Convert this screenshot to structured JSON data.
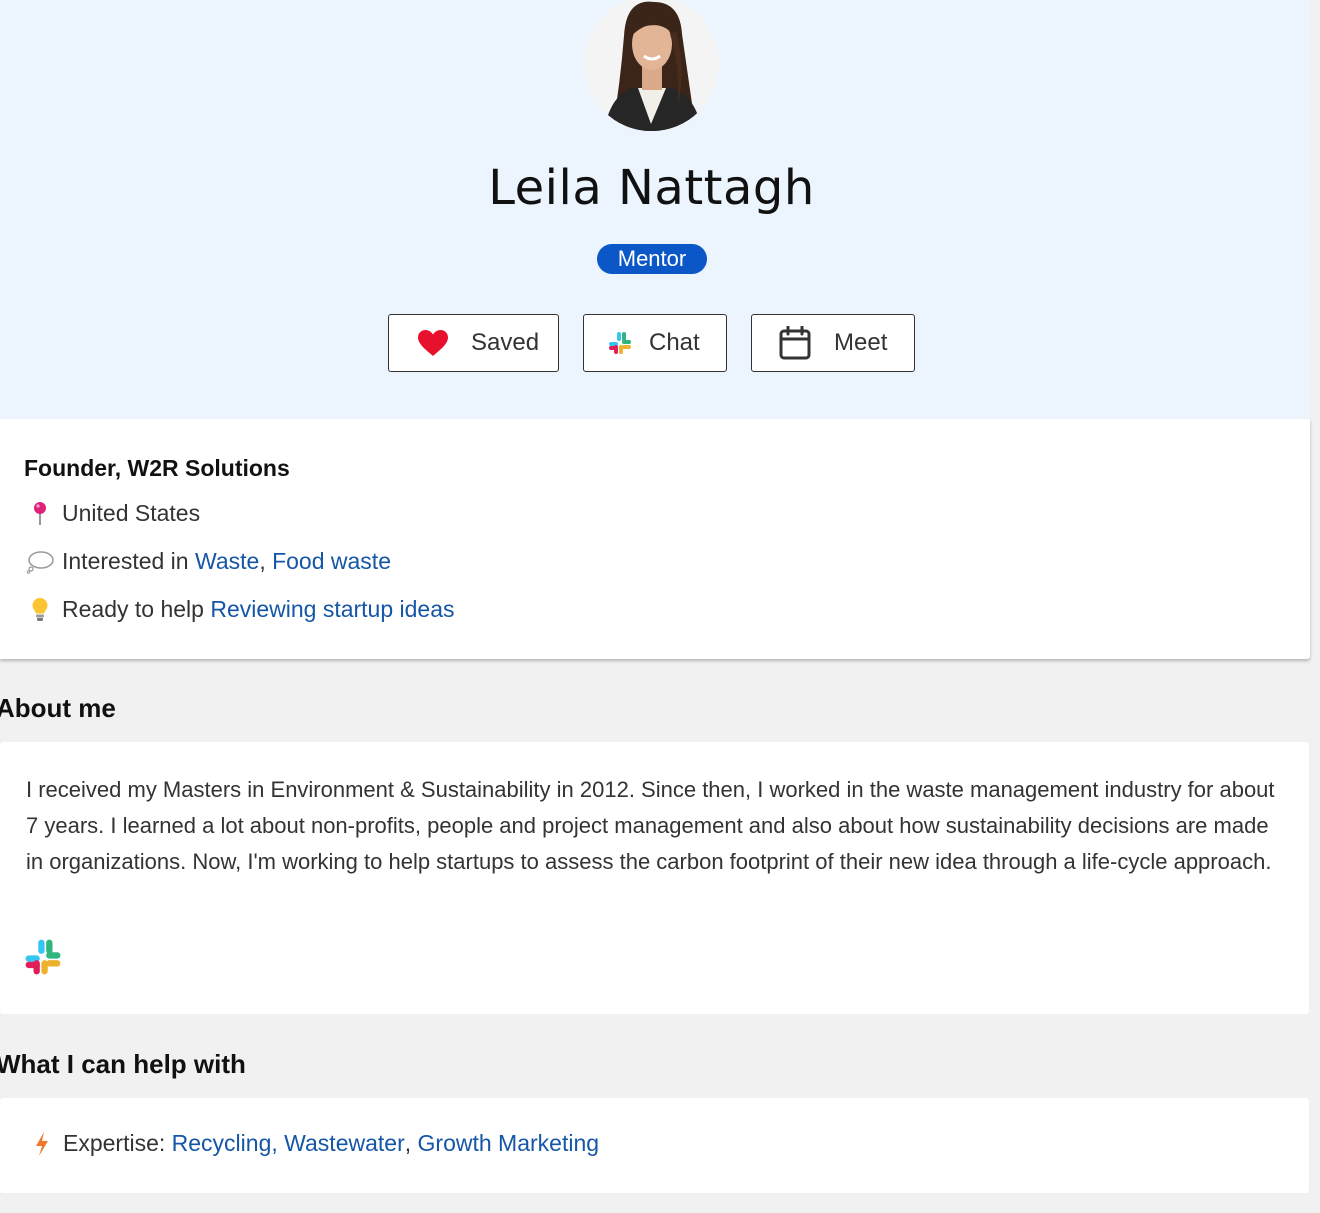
{
  "profile": {
    "name": "Leila Nattagh",
    "badge": "Mentor"
  },
  "actions": {
    "saved_label": "Saved",
    "chat_label": "Chat",
    "meet_label": "Meet"
  },
  "info": {
    "role": "Founder, W2R Solutions",
    "location": "United States",
    "interested_prefix": "Interested in",
    "interests": [
      "Waste",
      "Food waste"
    ],
    "separator": ",",
    "help_prefix": "Ready to help",
    "help_topic": "Reviewing startup ideas"
  },
  "about": {
    "title": "About me",
    "text": "I received my Masters in Environment & Sustainability in 2012. Since then, I worked in the waste management industry for about 7 years. I learned a lot about non-profits, people and project management and also about how sustainability decisions are made in organizations. Now, I'm working to help startups to assess the carbon footprint of their new idea through a life-cycle approach."
  },
  "help": {
    "title": "What I can help with",
    "expertise_prefix": "Expertise:",
    "expertise": [
      "Recycling",
      "Wastewater",
      "Growth Marketing"
    ],
    "separator": ","
  },
  "colors": {
    "hero_bg": "#ecf4fe",
    "badge_bg": "#0b57c8",
    "link": "#1556a6",
    "heart": "#e8112d"
  },
  "icons": {
    "saved": "heart-icon",
    "chat": "slack-icon",
    "meet": "calendar-icon",
    "location": "pin-icon",
    "interests": "speech-bubble-icon",
    "help": "lightbulb-icon",
    "expertise": "bolt-icon"
  }
}
